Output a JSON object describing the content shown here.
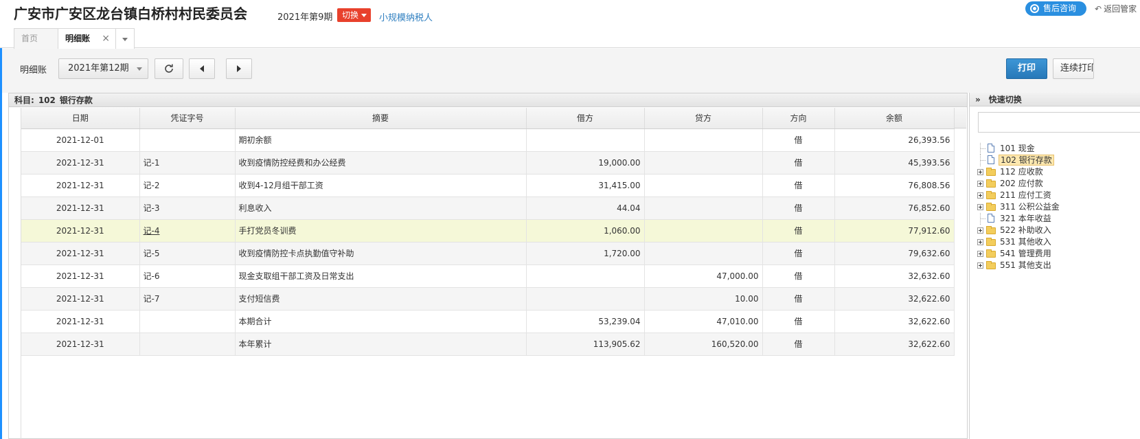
{
  "header": {
    "org_name": "广安市广安区龙台镇白桥村村民委员会",
    "period": "2021年第9期",
    "switch_label": "切换",
    "taxpayer_type": "小规模纳税人",
    "service_label": "售后咨询",
    "back_label": "返回管家"
  },
  "tabs": [
    {
      "label": "首页"
    },
    {
      "label": "明细账"
    }
  ],
  "toolbar": {
    "label": "明细账",
    "period_value": "2021年第12期",
    "print_label": "打印",
    "continuous_label": "连续打印"
  },
  "subject": {
    "prefix": "科目:",
    "code": "102",
    "name": "银行存款"
  },
  "table": {
    "columns": [
      "日期",
      "凭证字号",
      "摘要",
      "借方",
      "贷方",
      "方向",
      "余额"
    ],
    "rows": [
      {
        "date": "2021-12-01",
        "voucher": "",
        "summary": "期初余额",
        "debit": "",
        "credit": "",
        "direction": "借",
        "balance": "26,393.56"
      },
      {
        "date": "2021-12-31",
        "voucher": "记-1",
        "summary": "收到疫情防控经费和办公经费",
        "debit": "19,000.00",
        "credit": "",
        "direction": "借",
        "balance": "45,393.56"
      },
      {
        "date": "2021-12-31",
        "voucher": "记-2",
        "summary": "收到4-12月组干部工资",
        "debit": "31,415.00",
        "credit": "",
        "direction": "借",
        "balance": "76,808.56"
      },
      {
        "date": "2021-12-31",
        "voucher": "记-3",
        "summary": "利息收入",
        "debit": "44.04",
        "credit": "",
        "direction": "借",
        "balance": "76,852.60"
      },
      {
        "date": "2021-12-31",
        "voucher": "记-4",
        "summary": "手打党员冬训费",
        "debit": "1,060.00",
        "credit": "",
        "direction": "借",
        "balance": "77,912.60"
      },
      {
        "date": "2021-12-31",
        "voucher": "记-5",
        "summary": "收到疫情防控卡点执勤值守补助",
        "debit": "1,720.00",
        "credit": "",
        "direction": "借",
        "balance": "79,632.60"
      },
      {
        "date": "2021-12-31",
        "voucher": "记-6",
        "summary": "现金支取组干部工资及日常支出",
        "debit": "",
        "credit": "47,000.00",
        "direction": "借",
        "balance": "32,632.60"
      },
      {
        "date": "2021-12-31",
        "voucher": "记-7",
        "summary": "支付短信费",
        "debit": "",
        "credit": "10.00",
        "direction": "借",
        "balance": "32,622.60"
      },
      {
        "date": "2021-12-31",
        "voucher": "",
        "summary": "本期合计",
        "debit": "53,239.04",
        "credit": "47,010.00",
        "direction": "借",
        "balance": "32,622.60"
      },
      {
        "date": "2021-12-31",
        "voucher": "",
        "summary": "本年累计",
        "debit": "113,905.62",
        "credit": "160,520.00",
        "direction": "借",
        "balance": "32,622.60"
      }
    ]
  },
  "quick_switch": {
    "title": "快速切换",
    "search_value": "",
    "items": [
      {
        "label": "101 现金",
        "type": "doc",
        "expandable": false,
        "selected": false
      },
      {
        "label": "102 银行存款",
        "type": "doc",
        "expandable": false,
        "selected": true
      },
      {
        "label": "112 应收款",
        "type": "folder",
        "expandable": true,
        "selected": false
      },
      {
        "label": "202 应付款",
        "type": "folder",
        "expandable": true,
        "selected": false
      },
      {
        "label": "211 应付工资",
        "type": "folder",
        "expandable": true,
        "selected": false
      },
      {
        "label": "311 公积公益金",
        "type": "folder",
        "expandable": true,
        "selected": false
      },
      {
        "label": "321 本年收益",
        "type": "doc",
        "expandable": false,
        "selected": false
      },
      {
        "label": "522 补助收入",
        "type": "folder",
        "expandable": true,
        "selected": false
      },
      {
        "label": "531 其他收入",
        "type": "folder",
        "expandable": true,
        "selected": false
      },
      {
        "label": "541 管理费用",
        "type": "folder",
        "expandable": true,
        "selected": false
      },
      {
        "label": "551 其他支出",
        "type": "folder",
        "expandable": true,
        "selected": false
      }
    ]
  },
  "colors": {
    "accent_blue": "#2a8fe0",
    "switch_red": "#e8412c",
    "print_blue": "#2f86c7",
    "highlight_row": "#f5f8d8",
    "tree_selected": "#fde8b0"
  }
}
